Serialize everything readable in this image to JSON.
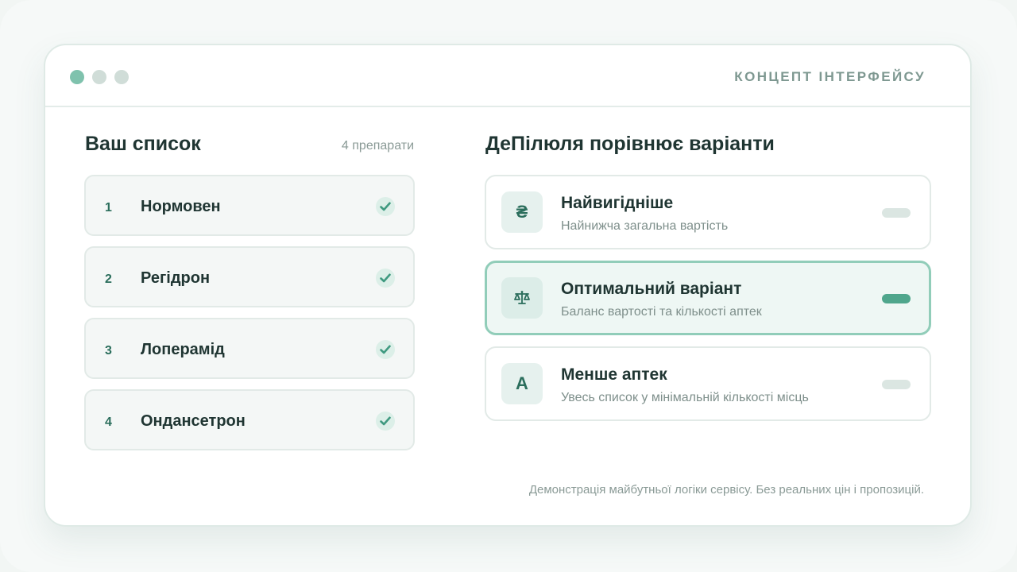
{
  "header": {
    "concept_label": "КОНЦЕПТ ІНТЕРФЕЙСУ"
  },
  "list": {
    "title": "Ваш список",
    "count": "4 препарати",
    "items": [
      {
        "num": "1",
        "name": "Нормовен",
        "checked": true
      },
      {
        "num": "2",
        "name": "Регідрон",
        "checked": true
      },
      {
        "num": "3",
        "name": "Лоперамід",
        "checked": true
      },
      {
        "num": "4",
        "name": "Ондансетрон",
        "checked": true
      }
    ]
  },
  "compare": {
    "title": "ДеПілюля порівнює варіанти",
    "options": [
      {
        "icon": "₴",
        "icon_name": "hryvnia-icon",
        "title": "Найвигідніше",
        "desc": "Найнижча загальна вартість",
        "selected": false
      },
      {
        "icon": "⚖",
        "icon_name": "scales-icon",
        "title": "Оптимальний варіант",
        "desc": "Баланс вартості та кількості аптек",
        "selected": true
      },
      {
        "icon": "A",
        "icon_name": "letter-a-icon",
        "title": "Менше аптек",
        "desc": "Увесь список у мінімальній кількості місць",
        "selected": false
      }
    ]
  },
  "footnote": "Демонстрація майбутньої логіки сервісу. Без реальних цін і пропозицій.",
  "colors": {
    "accent": "#4fa68c",
    "accent_dark": "#2b6e5c",
    "window_dot_active": "#7fc2ad",
    "window_dot_inactive": "#d0ddd8"
  }
}
